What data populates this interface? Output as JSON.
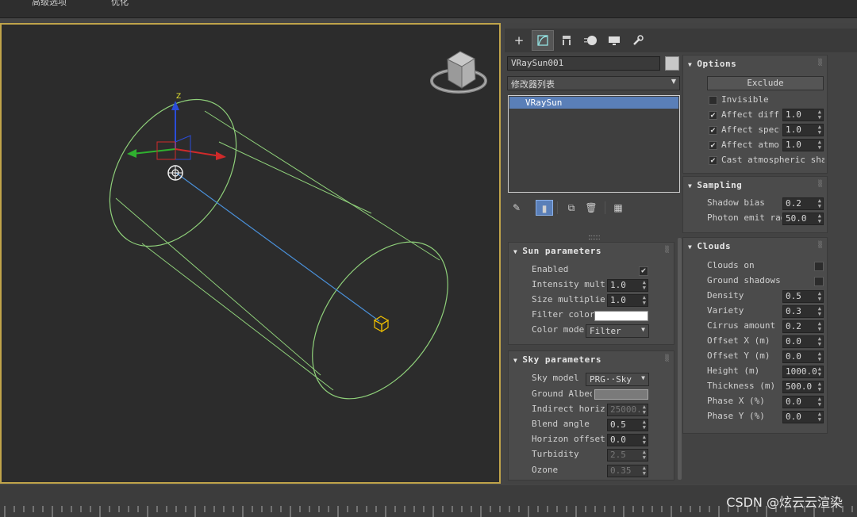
{
  "menubar": {
    "item1": "高级选项",
    "item2": "优化"
  },
  "command_tabs": [
    "create-icon",
    "modify-icon",
    "hierarchy-icon",
    "motion-icon",
    "display-icon",
    "utilities-icon"
  ],
  "object": {
    "name": "VRaySun001",
    "modifier_list": "修改器列表",
    "stack_item": "VRaySun"
  },
  "options": {
    "title": "Options",
    "exclude": "Exclude",
    "invisible": "Invisible",
    "affect_diffuse": {
      "label": "Affect diff",
      "value": "1.0"
    },
    "affect_specular": {
      "label": "Affect specu",
      "value": "1.0"
    },
    "affect_atmos": {
      "label": "Affect atmos",
      "value": "1.0"
    },
    "cast_atmos": "Cast atmospheric shado"
  },
  "sampling": {
    "title": "Sampling",
    "shadow_bias": {
      "label": "Shadow bias",
      "value": "0.2"
    },
    "photon_emit": {
      "label": "Photon emit radi",
      "value": "50.0"
    }
  },
  "clouds": {
    "title": "Clouds",
    "clouds_on": "Clouds on",
    "ground_shadows": "Ground shadows",
    "density": {
      "label": "Density",
      "value": "0.5"
    },
    "variety": {
      "label": "Variety",
      "value": "0.3"
    },
    "cirrus": {
      "label": "Cirrus amount",
      "value": "0.2"
    },
    "offset_x": {
      "label": "Offset X (m)",
      "value": "0.0"
    },
    "offset_y": {
      "label": "Offset Y (m)",
      "value": "0.0"
    },
    "height": {
      "label": "Height (m)",
      "value": "1000.0"
    },
    "thickness": {
      "label": "Thickness (m)",
      "value": "500.0"
    },
    "phase_x": {
      "label": "Phase X (%)",
      "value": "0.0"
    },
    "phase_y": {
      "label": "Phase Y (%)",
      "value": "0.0"
    }
  },
  "sun": {
    "title": "Sun parameters",
    "enabled": "Enabled",
    "intensity": {
      "label": "Intensity multip",
      "value": "1.0"
    },
    "size": {
      "label": "Size multiplier",
      "value": "1.0"
    },
    "filter_color": "Filter color",
    "color_mode": {
      "label": "Color mode",
      "value": "Filter"
    }
  },
  "sky": {
    "title": "Sky parameters",
    "model": {
      "label": "Sky model",
      "value": "PRG··Sky"
    },
    "ground_albedo": "Ground Albedo",
    "indirect_horiz": {
      "label": "Indirect horiz i",
      "value": "25000."
    },
    "blend_angle": {
      "label": "Blend angle",
      "value": "0.5"
    },
    "horizon_offset": {
      "label": "Horizon offset",
      "value": "0.0"
    },
    "turbidity": {
      "label": "Turbidity",
      "value": "2.5"
    },
    "ozone": {
      "label": "Ozone",
      "value": "0.35"
    }
  },
  "gizmo_axis_label": "Z",
  "watermark": "CSDN @炫云云渲染",
  "colors": {
    "viewport_border": "#c0a44a",
    "selection": "#5a7fb8",
    "wire": "#9fd88a",
    "sun_line": "#4a90d9",
    "target": "#f0c000"
  }
}
